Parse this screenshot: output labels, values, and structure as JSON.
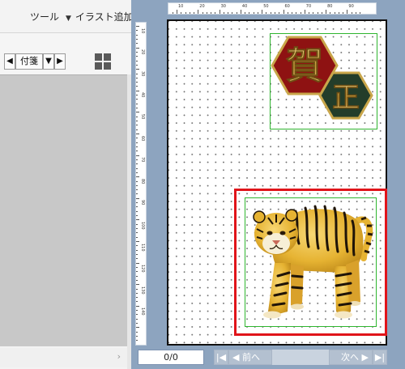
{
  "menu": {
    "tools_label": "ツール",
    "add_illustration_label": "イラスト追加"
  },
  "toolbar": {
    "prev_label": "◀",
    "selected_value": "付箋",
    "dropdown_label": "▼",
    "next_label": "▶",
    "view_icon": "grid-view-icon"
  },
  "sidebar": {
    "scroll_arrow": "›"
  },
  "rulers": {
    "top_labels": [
      "10",
      "20",
      "30",
      "40",
      "50",
      "60",
      "70",
      "80",
      "90"
    ],
    "left_labels": [
      "10",
      "20",
      "30",
      "40",
      "50",
      "60",
      "70",
      "80",
      "90",
      "100",
      "110",
      "120",
      "130",
      "140"
    ]
  },
  "canvas": {
    "kanji_1": "賀",
    "kanji_2": "正",
    "image_subject": "tiger",
    "colors": {
      "selection": "#e0141a",
      "group_outline": "#2fb52f",
      "kanji_1_bg": "#8e1212",
      "kanji_2_bg": "#233d2a",
      "kanji_border": "#c9a64a",
      "workspace_bg": "#8da4bf"
    }
  },
  "navigation": {
    "page_counter": "0/0",
    "first_label": "|◀",
    "prev_label": "◀ 前へ",
    "next_label": "次へ ▶",
    "last_label": "▶|"
  }
}
